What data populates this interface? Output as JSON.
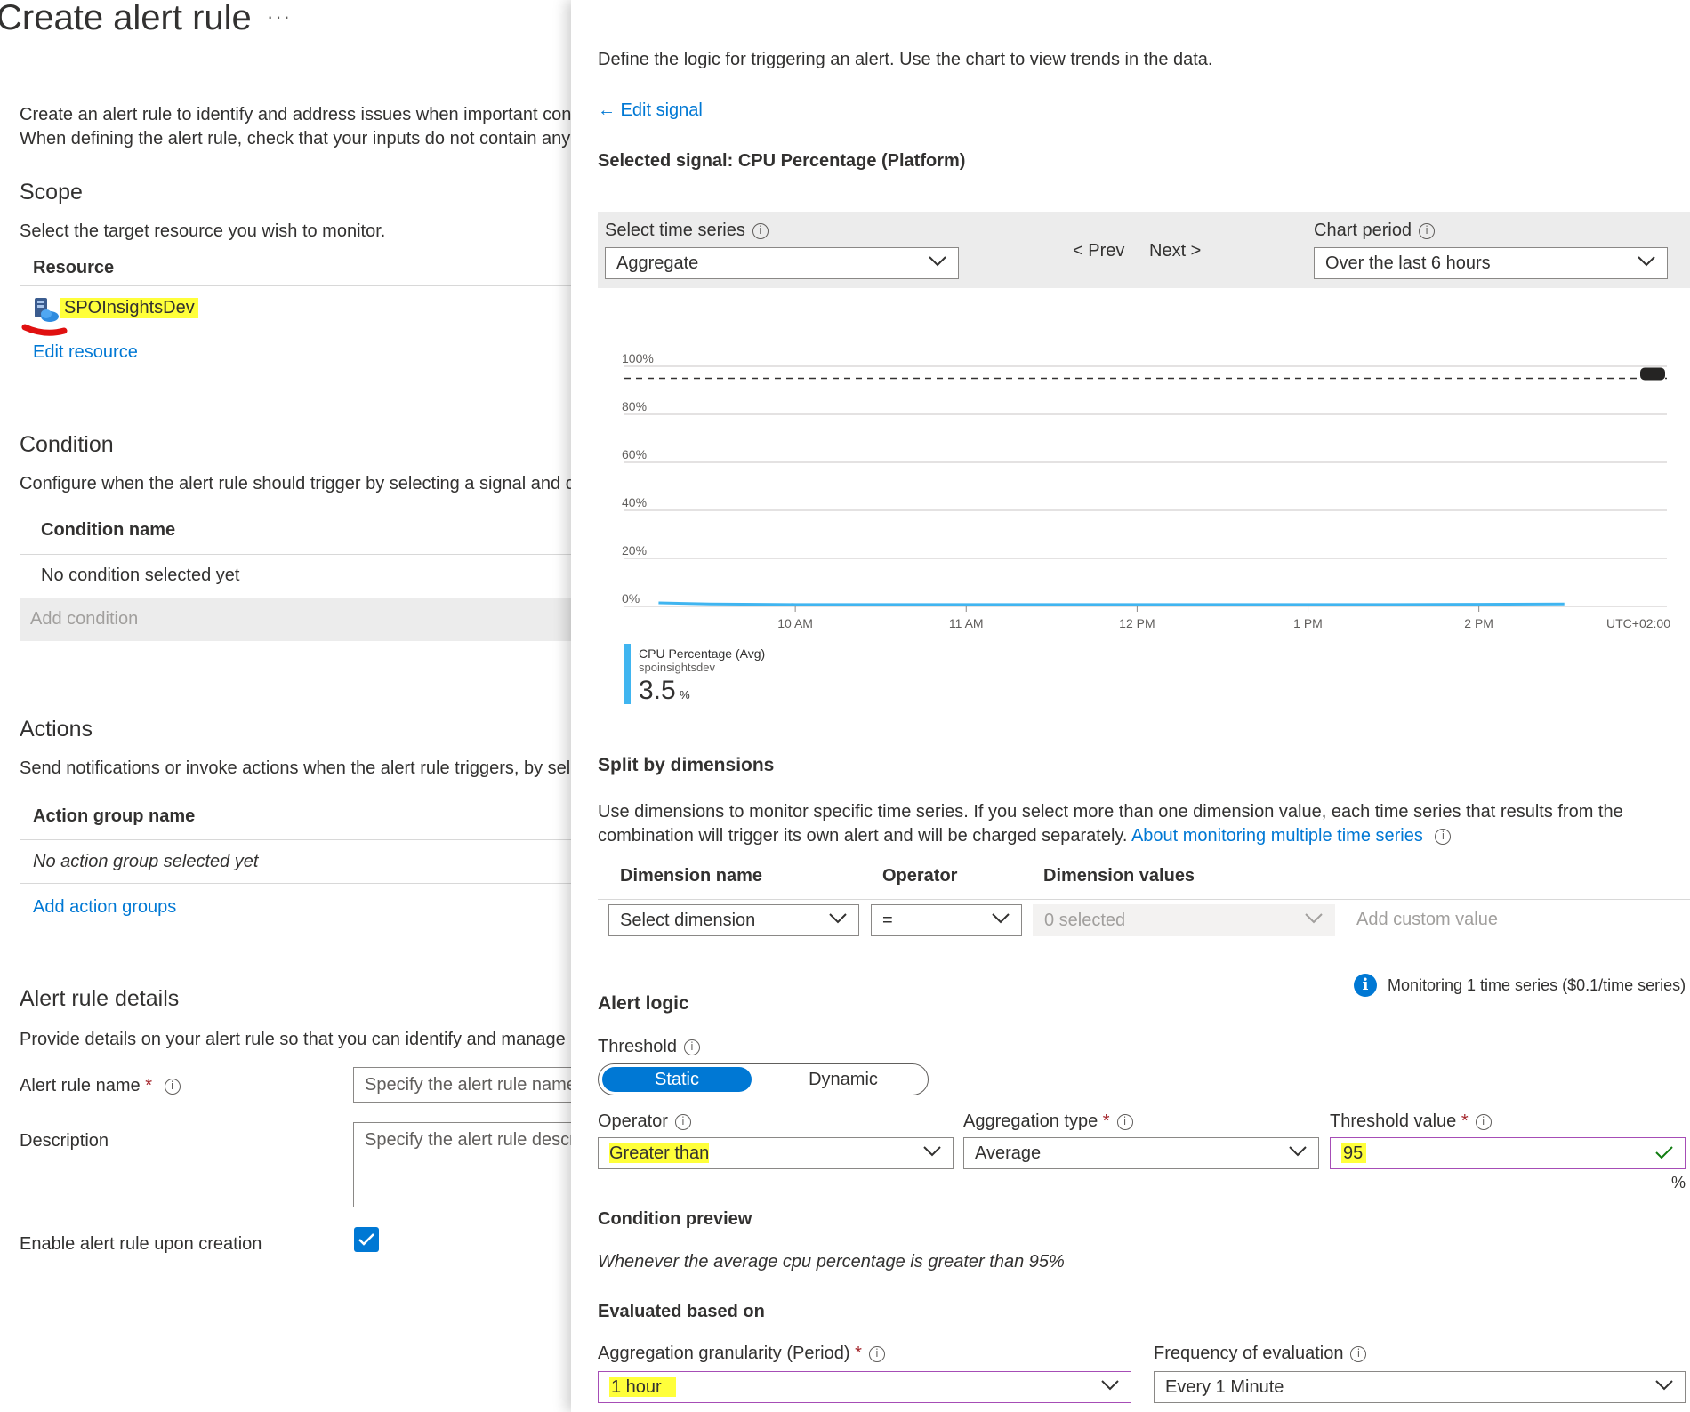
{
  "page": {
    "title": "Create alert rule",
    "more_label": "···"
  },
  "intro": {
    "line1": "Create an alert rule to identify and address issues when important conditions are found in your monitoring data. Learn more",
    "line2": "When defining the alert rule, check that your inputs do not contain any sensitive content."
  },
  "scope": {
    "heading": "Scope",
    "description": "Select the target resource you wish to monitor.",
    "column_header": "Resource",
    "resource_name": "SPOInsightsDev",
    "edit_link": "Edit resource"
  },
  "condition": {
    "heading": "Condition",
    "description": "Configure when the alert rule should trigger by selecting a signal and defining its logic.",
    "column_header": "Condition name",
    "empty_text": "No condition selected yet",
    "add_button": "Add condition"
  },
  "actions": {
    "heading": "Actions",
    "description": "Send notifications or invoke actions when the alert rule triggers, by selecting or creating a new action group.",
    "column_header": "Action group name",
    "empty_text": "No action group selected yet",
    "add_link": "Add action groups"
  },
  "details": {
    "heading": "Alert rule details",
    "description": "Provide details on your alert rule so that you can identify and manage it later.",
    "name_label": "Alert rule name",
    "required_mark": "*",
    "name_placeholder": "Specify the alert rule name",
    "description_label": "Description",
    "description_placeholder": "Specify the alert rule description",
    "enable_label": "Enable alert rule upon creation",
    "enable_checked": true
  },
  "panel": {
    "intro": "Define the logic for triggering an alert. Use the chart to view trends in the data.",
    "edit_signal": "← Edit signal",
    "selected_signal": "Selected signal: CPU Percentage (Platform)",
    "time_series_label": "Select time series",
    "time_series_value": "Aggregate",
    "prev_label": "< Prev",
    "next_label": "Next >",
    "chart_period_label": "Chart period",
    "chart_period_value": "Over the last 6 hours"
  },
  "chart_data": {
    "type": "line",
    "title": "",
    "xlabel": "",
    "ylabel": "",
    "y_ticks": [
      "100%",
      "80%",
      "60%",
      "40%",
      "20%",
      "0%"
    ],
    "y_tick_values": [
      100,
      80,
      60,
      40,
      20,
      0
    ],
    "ylim": [
      0,
      100
    ],
    "x_ticks": [
      "10 AM",
      "11 AM",
      "12 PM",
      "1 PM",
      "2 PM"
    ],
    "x_tick_hours": [
      10,
      11,
      12,
      13,
      14
    ],
    "xlim_hours": [
      9.0,
      15.1
    ],
    "timezone_label": "UTC+02:00",
    "threshold": 95,
    "grid": true,
    "series": [
      {
        "name": "CPU Percentage (Avg)",
        "color": "#40b5f0",
        "x_hours": [
          9.2,
          9.5,
          10.0,
          10.5,
          11.0,
          11.5,
          12.0,
          12.5,
          13.0,
          13.5,
          14.0,
          14.5
        ],
        "values": [
          1.5,
          1.0,
          0.8,
          0.8,
          0.8,
          0.8,
          0.8,
          0.8,
          0.8,
          0.8,
          0.9,
          1.0
        ]
      }
    ],
    "legend": {
      "series_label": "CPU Percentage (Avg)",
      "resource": "spoinsightsdev",
      "value": "3.5",
      "unit": "%"
    }
  },
  "split": {
    "heading": "Split by dimensions",
    "description_line1": "Use dimensions to monitor specific time series. If you select more than one dimension value, each time series that results from the",
    "description_line2": "combination will trigger its own alert and will be charged separately.",
    "link": "About monitoring multiple time series",
    "col_dimension": "Dimension name",
    "col_operator": "Operator",
    "col_values": "Dimension values",
    "dimension_placeholder": "Select dimension",
    "operator_value": "=",
    "values_placeholder": "0 selected",
    "custom_value": "Add custom value"
  },
  "monitoring_note": "Monitoring 1 time series ($0.1/time series)",
  "alert_logic": {
    "heading": "Alert logic",
    "threshold_label": "Threshold",
    "static_label": "Static",
    "dynamic_label": "Dynamic",
    "operator_label": "Operator",
    "operator_value": "Greater than",
    "aggregation_label": "Aggregation type",
    "aggregation_value": "Average",
    "threshold_value_label": "Threshold value",
    "threshold_value": "95",
    "unit": "%",
    "required_mark": "*"
  },
  "preview": {
    "heading": "Condition preview",
    "text": "Whenever the average cpu percentage is greater than 95%"
  },
  "evaluation": {
    "heading": "Evaluated based on",
    "granularity_label": "Aggregation granularity (Period)",
    "granularity_value": "1 hour",
    "frequency_label": "Frequency of evaluation",
    "frequency_value": "Every 1 Minute",
    "required_mark": "*"
  },
  "colors": {
    "accent": "#0078d4",
    "highlight": "#ffff3a",
    "series": "#40b5f0",
    "required": "#a4262c",
    "valid": "#107c10"
  }
}
